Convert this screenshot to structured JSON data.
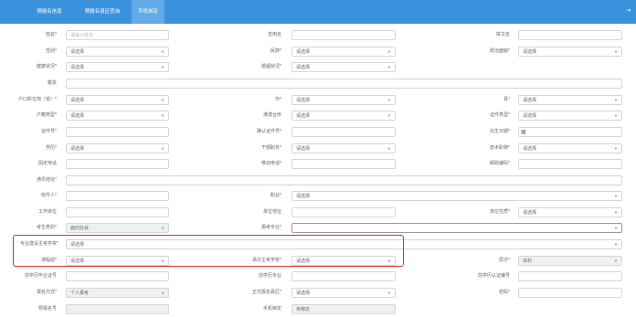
{
  "nav": {
    "tabs": [
      {
        "label": "预报名信息"
      },
      {
        "label": "预报名县区查询"
      },
      {
        "label": "手机绑定"
      }
    ],
    "active_tab": 2,
    "logout_icon": "logout-icon"
  },
  "form": {
    "name_label": "姓名*",
    "name_placeholder": "请输入姓名",
    "used_name_label": "曾用名",
    "pinyin_label": "拼文名",
    "gender_label": "性别*",
    "ethnicity_label": "民族*",
    "politics_label": "政治面貌*",
    "health_label": "健康状况*",
    "marital_label": "婚姻状况*",
    "native_label": "籍贯",
    "hukou_label": "户口所在地（省）*",
    "city_label": "市*",
    "county_label": "县*",
    "hukou_type_label": "户籍类型*",
    "hk_macau_label": "港澳台侨",
    "id_type_label": "证件类型*",
    "id_no_label": "证件号*",
    "id_confirm_label": "确认证件号*",
    "birthday_label": "出生日期*",
    "education_label": "学历*",
    "cadre_label": "干部职务*",
    "tech_title_label": "技术职称*",
    "phone_label": "固定电话",
    "mobile_label": "移动电话*",
    "postcode_label": "邮政编码*",
    "address_label": "通讯地址*",
    "recipient_label": "收件人*",
    "occupation_label": "职业*",
    "workplace_label": "工作单位",
    "work_address_label": "单位地址",
    "work_nature_label": "单位性质*",
    "candidate_type_label": "考生类别*",
    "candidate_type_value": "面向社会",
    "major_label": "报考专业*",
    "major_school_label": "专业建设主考学校*",
    "course_label": "课程组*",
    "host_school_label": "承办主考学校*",
    "level_label": "层次*",
    "level_value": "本科",
    "prev_cert_label": "前学历毕业证号",
    "prev_major_label": "前学历专业",
    "prev_verify_label": "前学历认证编号",
    "signup_method_label": "报名方式*",
    "signup_method_value": "个人报考",
    "official_district_label": "正式报名县区*",
    "password_label": "密码*",
    "pre_no_label": "预报名号",
    "mobile_bind_label": "手机绑定",
    "mobile_bind_value": "未绑定",
    "select_placeholder": "请选择"
  },
  "icons": {
    "dropdown": "chevron-down-icon",
    "calendar": "calendar-icon"
  },
  "colors": {
    "topbar": "#3b92dc",
    "active_tab": "#62a9e6",
    "highlight": "#d8322f"
  }
}
